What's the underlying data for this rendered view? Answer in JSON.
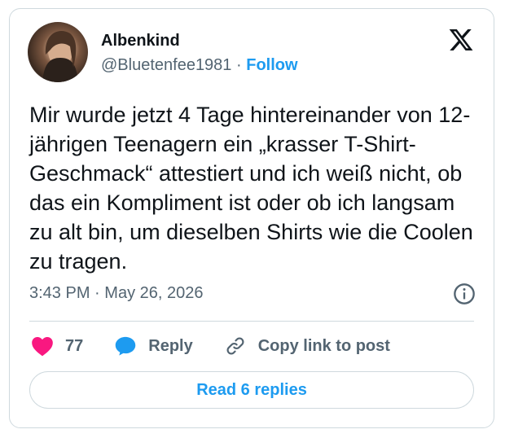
{
  "author": {
    "name": "Albenkind",
    "handle": "@Bluetenfee1981",
    "separator": "·",
    "follow_label": "Follow"
  },
  "post": {
    "text": "Mir wurde jetzt 4 Tage hintereinander von 12-jährigen Teenagern ein „krasser T-Shirt-Geschmack“ attestiert und ich weiß nicht, ob das ein Kompliment ist oder ob ich langsam zu alt bin, um dieselben Shirts wie die Coolen zu tragen.",
    "time": "3:43 PM",
    "date_separator": "·",
    "date": "May 26, 2026"
  },
  "actions": {
    "like_count": "77",
    "reply_label": "Reply",
    "copy_label": "Copy link to post"
  },
  "read_replies_label": "Read 6 replies",
  "icons": {
    "logo": "x-logo-icon",
    "info": "info-icon",
    "like": "heart-icon",
    "reply": "speech-bubble-icon",
    "copy": "link-icon"
  },
  "colors": {
    "accent": "#1d9bf0",
    "like": "#f91880",
    "text": "#0f1419",
    "muted": "#536471",
    "border": "#cfd9de"
  }
}
